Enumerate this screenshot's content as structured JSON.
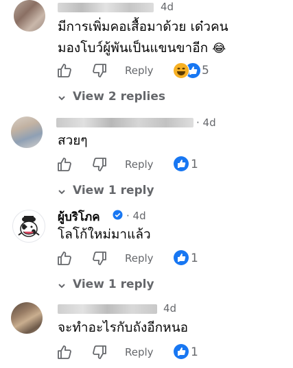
{
  "comments": [
    {
      "time": "4d",
      "text_line1": "มีการเพิ่มคอเสื้อมาด้วย เด๋วคน",
      "text_line2": "มองโบว์ผู้พันเป็นแขนขาอีก",
      "emoji": "😂",
      "reply_label": "Reply",
      "reaction_count": "5",
      "reactions": [
        "haha-icon",
        "like-icon"
      ]
    },
    {
      "time": "· 4d",
      "text": "สวยๆ",
      "reply_label": "Reply",
      "reaction_count": "1",
      "reactions": [
        "like-icon"
      ]
    },
    {
      "author": "ผู้บริโภค",
      "verified": true,
      "time": "· 4d",
      "text": "โลโก้ใหม่มาแล้ว",
      "reply_label": "Reply",
      "reaction_count": "1",
      "reactions": [
        "like-icon"
      ]
    },
    {
      "time": "4d",
      "text": "จะทำอะไรกับถังอีกหนอ",
      "reply_label": "Reply",
      "reaction_count": "1",
      "reactions": [
        "like-icon"
      ]
    }
  ],
  "view_replies": [
    "View 2 replies",
    "View 1 reply",
    "View 1 reply"
  ],
  "colors": {
    "like_blue": "#1877f2",
    "secondary_text": "#65676b",
    "haha_yellow": "#f7b125"
  }
}
